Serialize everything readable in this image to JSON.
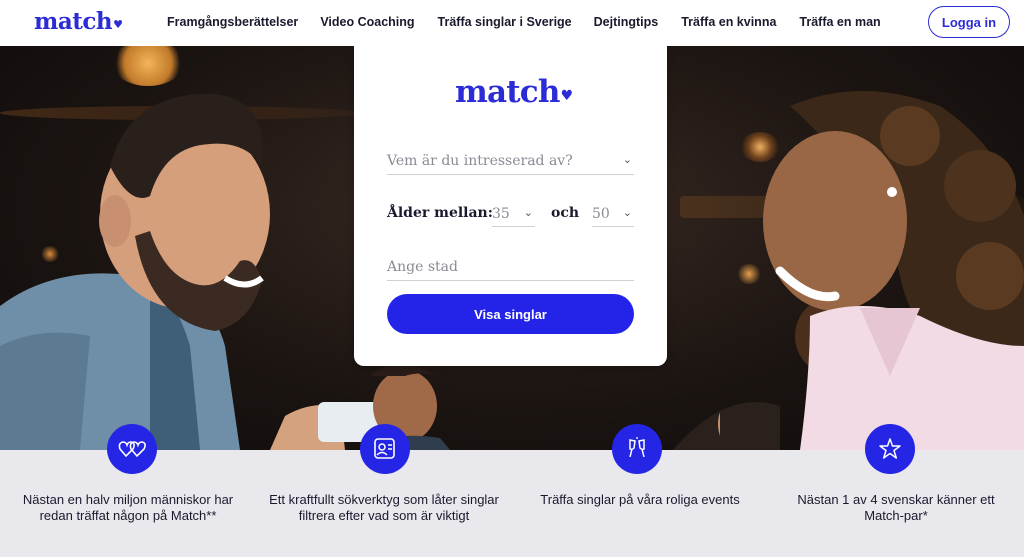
{
  "header": {
    "logo": "match",
    "nav": [
      "Framgångsberättelser",
      "Video Coaching",
      "Träffa singlar i Sverige",
      "Dejtingtips",
      "Träffa en kvinna",
      "Träffa en man"
    ],
    "login_label": "Logga in"
  },
  "search": {
    "logo": "match",
    "interest_placeholder": "Vem är du intresserad av?",
    "age_label": "Ålder mellan:",
    "age_min": "35",
    "age_connector": "och",
    "age_max": "50",
    "city_placeholder": "Ange stad",
    "submit_label": "Visa singlar"
  },
  "features": [
    {
      "icon": "hearts-icon",
      "text": "Nästan en halv miljon människor har redan träffat någon på Match**"
    },
    {
      "icon": "profile-search-icon",
      "text": "Ett kraftfullt sökverktyg som låter singlar filtrera efter vad som är viktigt"
    },
    {
      "icon": "cheers-icon",
      "text": "Träffa singlar på våra roliga events"
    },
    {
      "icon": "star-badge-icon",
      "text": "Nästan 1 av 4 svenskar känner ett Match-par*"
    }
  ],
  "colors": {
    "brand": "#2c2cd6",
    "cta": "#2424e8"
  }
}
